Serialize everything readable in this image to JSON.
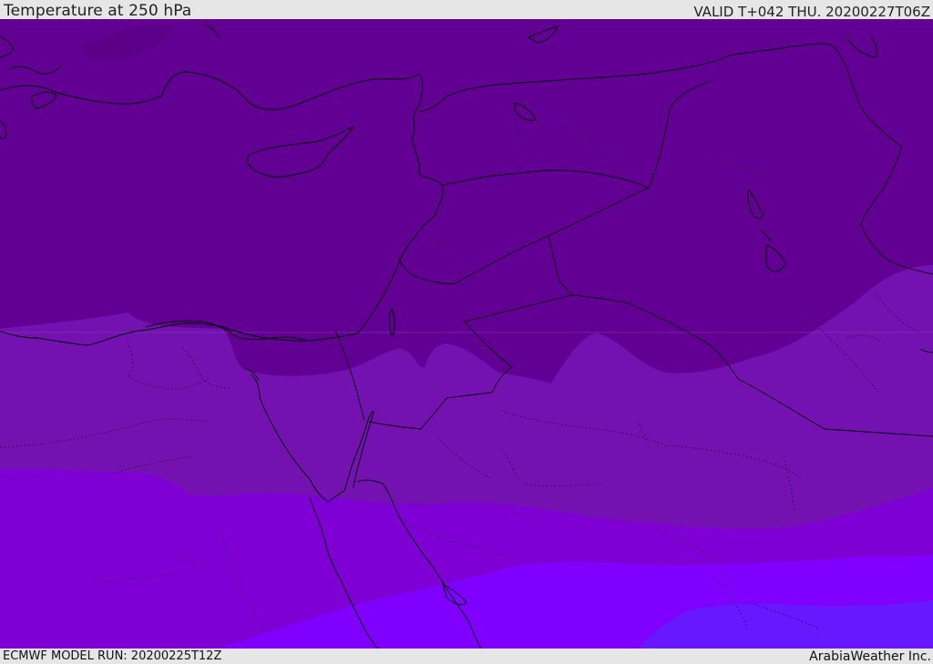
{
  "header": {
    "title": "Temperature at 250 hPa",
    "valid": "VALID T+042 THU. 20200227T06Z"
  },
  "footer": {
    "model_run": "ECMWF MODEL RUN: 20200225T12Z",
    "credit": "ArabiaWeather Inc."
  },
  "map": {
    "region": "Eastern Mediterranean / Middle East",
    "shading_colors": [
      "#620093",
      "#7312b0",
      "#7f00d4",
      "#8000ff",
      "#6818ff"
    ],
    "coastline_color": "#000000",
    "border_color": "#000000"
  }
}
